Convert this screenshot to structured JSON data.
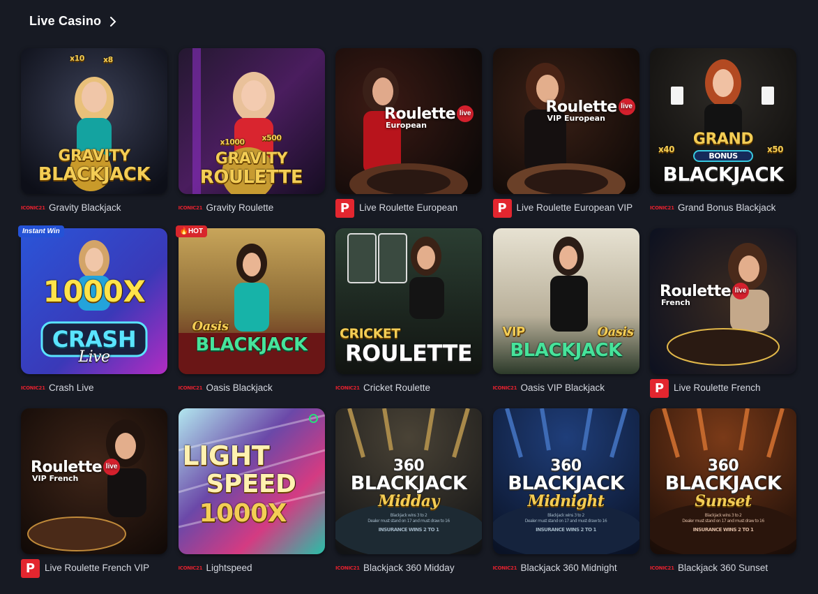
{
  "section": {
    "title": "Live Casino"
  },
  "badges": {
    "instant": "Instant Win",
    "hot": "🔥HOT"
  },
  "provider_text": "ICONIC21",
  "provider_p": "P",
  "live_label": "live",
  "tiles": [
    {
      "name": "Gravity Blackjack",
      "provider": "iconic21",
      "art1": "GRAVITY",
      "art2": "BLACKJACK",
      "mult1": "x10",
      "mult2": "x8"
    },
    {
      "name": "Gravity Roulette",
      "provider": "iconic21",
      "art1": "GRAVITY",
      "art2": "ROULETTE",
      "mult1": "x1000",
      "mult2": "x500"
    },
    {
      "name": "Live Roulette European",
      "provider": "pragmatic",
      "logo": "Roulette",
      "sub": "European"
    },
    {
      "name": "Live Roulette European VIP",
      "provider": "pragmatic",
      "logo": "Roulette",
      "sub": "VIP European"
    },
    {
      "name": "Grand Bonus Blackjack",
      "provider": "iconic21",
      "art1": "GRAND",
      "art_mid": "BONUS",
      "art2": "BLACKJACK",
      "mult1": "x40",
      "mult2": "x50"
    },
    {
      "name": "Crash Live",
      "provider": "iconic21",
      "art1": "1000X",
      "art2": "CRASH",
      "art3": "Live"
    },
    {
      "name": "Oasis Blackjack",
      "provider": "iconic21",
      "art1": "Oasis",
      "art2": "BLACKJACK"
    },
    {
      "name": "Cricket Roulette",
      "provider": "iconic21",
      "art1": "CRICKET",
      "art2": "ROULETTE"
    },
    {
      "name": "Oasis VIP Blackjack",
      "provider": "iconic21",
      "art1": "VIP",
      "art_mid": "Oasis",
      "art2": "BLACKJACK"
    },
    {
      "name": "Live Roulette French",
      "provider": "pragmatic",
      "logo": "Roulette",
      "sub": "French"
    },
    {
      "name": "Live Roulette French VIP",
      "provider": "pragmatic",
      "logo": "Roulette",
      "sub": "VIP French"
    },
    {
      "name": "Lightspeed",
      "provider": "iconic21",
      "art1": "LIGHT",
      "art_mid": "SPEED",
      "art2": "1000X"
    },
    {
      "name": "Blackjack 360 Midday",
      "provider": "iconic21",
      "art1": "360",
      "art2": "BLACKJACK",
      "art3": "Midday",
      "fine1": "Dealer must stand on 17 and must draw to 16",
      "fine2": "INSURANCE WINS 2 TO 1",
      "fine0": "Blackjack wins 3 to 2"
    },
    {
      "name": "Blackjack 360 Midnight",
      "provider": "iconic21",
      "art1": "360",
      "art2": "BLACKJACK",
      "art3": "Midnight",
      "fine1": "Dealer must stand on 17 and must draw to 16",
      "fine2": "INSURANCE WINS 2 TO 1",
      "fine0": "Blackjack wins 3 to 2"
    },
    {
      "name": "Blackjack 360 Sunset",
      "provider": "iconic21",
      "art1": "360",
      "art2": "BLACKJACK",
      "art3": "Sunset",
      "fine1": "Dealer must stand on 17 and must draw to 16",
      "fine2": "INSURANCE WINS 2 TO 1",
      "fine0": "Blackjack wins 3 to 2"
    }
  ]
}
